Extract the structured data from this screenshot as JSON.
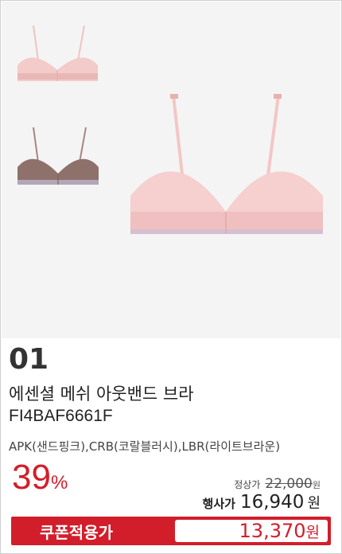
{
  "product": {
    "number": "01",
    "title": "에센셜 메쉬 아웃밴드 브라",
    "code": "FI4BAF6661F",
    "colors": "APK(샌드핑크),CRB(코랄블러시),LBR(라이트브라운)",
    "images": [
      "bra-pink-small",
      "bra-brown-small",
      "bra-pink-large"
    ]
  },
  "pricing": {
    "discount_rate": "39",
    "discount_unit": "%",
    "regular_label": "정상가",
    "regular_price": "22,000",
    "regular_unit": "원",
    "sale_label": "행사가",
    "sale_price": "16,940",
    "sale_unit": "원",
    "coupon_label": "쿠폰적용가",
    "coupon_price": "13,370",
    "coupon_unit": "원"
  },
  "colors": {
    "accent": "#d21e2b",
    "pink": "#f1c7c7",
    "brown": "#8a6a66"
  }
}
